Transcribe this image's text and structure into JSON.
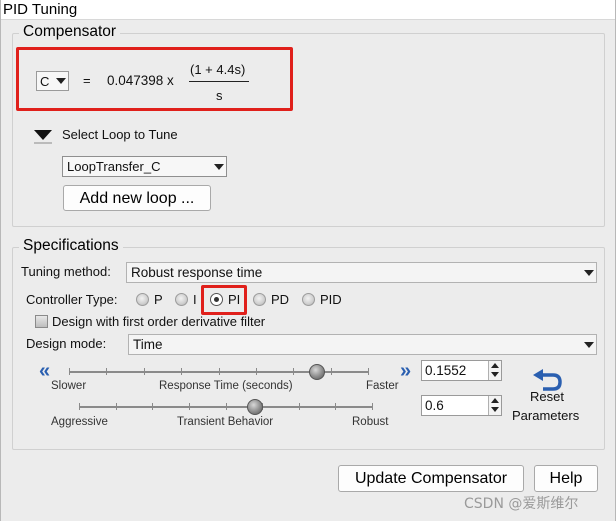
{
  "window": {
    "title": "PID Tuning"
  },
  "compensator": {
    "group_title": "Compensator",
    "variable": "C",
    "equals": "=",
    "gain_expr": "0.047398 x",
    "numerator": "(1 + 4.4s)",
    "denominator": "s",
    "select_loop_label": "Select Loop to Tune",
    "loop_value": "LoopTransfer_C",
    "add_loop_label": "Add new loop ..."
  },
  "specifications": {
    "group_title": "Specifications",
    "tuning_method_label": "Tuning method:",
    "tuning_method_value": "Robust response time",
    "controller_type_label": "Controller Type:",
    "controller_types": [
      "P",
      "I",
      "PI",
      "PD",
      "PID"
    ],
    "selected_controller_type": "PI",
    "derivative_filter_label": "Design with first order derivative filter",
    "design_mode_label": "Design mode:",
    "design_mode_value": "Time",
    "response_slider": {
      "left_label": "Slower",
      "center_label": "Response Time (seconds)",
      "right_label": "Faster",
      "value": "0.1552",
      "position_fraction": 0.83
    },
    "transient_slider": {
      "left_label": "Aggressive",
      "center_label": "Transient Behavior",
      "right_label": "Robust",
      "value": "0.6",
      "position_fraction": 0.6
    },
    "reset_label_1": "Reset",
    "reset_label_2": "Parameters"
  },
  "footer": {
    "update_label": "Update Compensator",
    "help_label": "Help"
  },
  "watermark": "CSDN @爱斯维尔",
  "colors": {
    "highlight": "#e0201b",
    "accent_arrow": "#2a5fb0"
  }
}
